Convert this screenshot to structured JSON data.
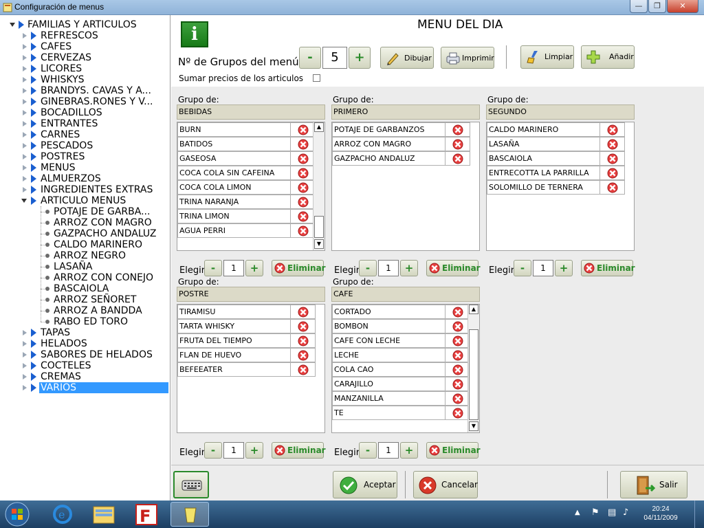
{
  "window": {
    "title": "Configuración de menus"
  },
  "tree": {
    "root": "FAMILIAS Y ARTICULOS",
    "families_before": [
      "REFRESCOS",
      "CAFES",
      "CERVEZAS",
      "LICORES",
      "WHISKYS",
      "BRANDYS. CAVAS Y A...",
      "GINEBRAS.RONES Y V...",
      "BOCADILLOS",
      "ENTRANTES",
      "CARNES",
      "PESCADOS",
      "POSTRES",
      "MENUS",
      "ALMUERZOS",
      "INGREDIENTES EXTRAS"
    ],
    "expanded": "ARTICULO MENUS",
    "articles": [
      "POTAJE DE GARBA...",
      "ARROZ CON MAGRO",
      "GAZPACHO ANDALUZ",
      "CALDO MARINERO",
      "ARROZ NEGRO",
      "LASAÑA",
      "ARROZ CON CONEJO",
      "BASCAIOLA",
      "ARROZ SEÑORET",
      "ARROZ A BANDDA",
      "RABO ED TORO"
    ],
    "families_after": [
      "TAPAS",
      "HELADOS",
      "SABORES DE HELADOS",
      "COCTELES",
      "CREMAS",
      "VARIOS"
    ],
    "selected": "VARIOS"
  },
  "header": {
    "info_icon": "i",
    "title": "MENU DEL DIA",
    "groups_label": "Nº de Grupos del menú:",
    "minus": "-",
    "plus": "+",
    "groups_value": "5",
    "dibujar": "Dibujar",
    "imprimir": "Imprimir",
    "limpiar": "Limpiar",
    "anadir": "Añadir",
    "sumar_label": "Sumar precios de los articulos"
  },
  "groups": [
    {
      "label": "Grupo de:",
      "name": "BEBIDAS",
      "items": [
        "BURN",
        "BATIDOS",
        "GASEOSA",
        "COCA COLA SIN CAFEINA",
        "COCA COLA LIMON",
        "TRINA NARANJA",
        "TRINA LIMON",
        "AGUA PERRI"
      ],
      "elegir_label": "Elegir",
      "elegir": "1",
      "eliminar": "Eliminar",
      "scrollbar": true
    },
    {
      "label": "Grupo de:",
      "name": "PRIMERO",
      "items": [
        "POTAJE DE GARBANZOS",
        "ARROZ CON MAGRO",
        "GAZPACHO ANDALUZ"
      ],
      "elegir_label": "Elegir",
      "elegir": "1",
      "eliminar": "Eliminar",
      "scrollbar": false
    },
    {
      "label": "Grupo de:",
      "name": "SEGUNDO",
      "items": [
        "CALDO MARINERO",
        "LASAÑA",
        "BASCAIOLA",
        "ENTRECOTTA LA PARRILLA",
        "SOLOMILLO DE TERNERA"
      ],
      "elegir_label": "Elegir",
      "elegir": "1",
      "eliminar": "Eliminar",
      "scrollbar": false
    },
    {
      "label": "Grupo de:",
      "name": "POSTRE",
      "items": [
        "TIRAMISU",
        "TARTA WHISKY",
        "FRUTA DEL TIEMPO",
        "FLAN DE HUEVO",
        "BEFEEATER"
      ],
      "elegir_label": "Elegir",
      "elegir": "1",
      "eliminar": "Eliminar",
      "scrollbar": false
    },
    {
      "label": "Grupo de:",
      "name": "CAFE",
      "items": [
        "CORTADO",
        "BOMBON",
        "CAFE CON LECHE",
        "LECHE",
        "COLA CAO",
        "CARAJILLO",
        "MANZANILLA",
        "TE"
      ],
      "elegir_label": "Elegir",
      "elegir": "1",
      "eliminar": "Eliminar",
      "scrollbar": true
    }
  ],
  "footer": {
    "aceptar": "Aceptar",
    "cancelar": "Cancelar",
    "salir": "Salir"
  },
  "taskbar": {
    "time": "20:24",
    "date": "04/11/2009"
  },
  "colors": {
    "accent_green": "#2a8a2a",
    "selection": "#3399ff",
    "group_bar": "#dcdac8"
  }
}
